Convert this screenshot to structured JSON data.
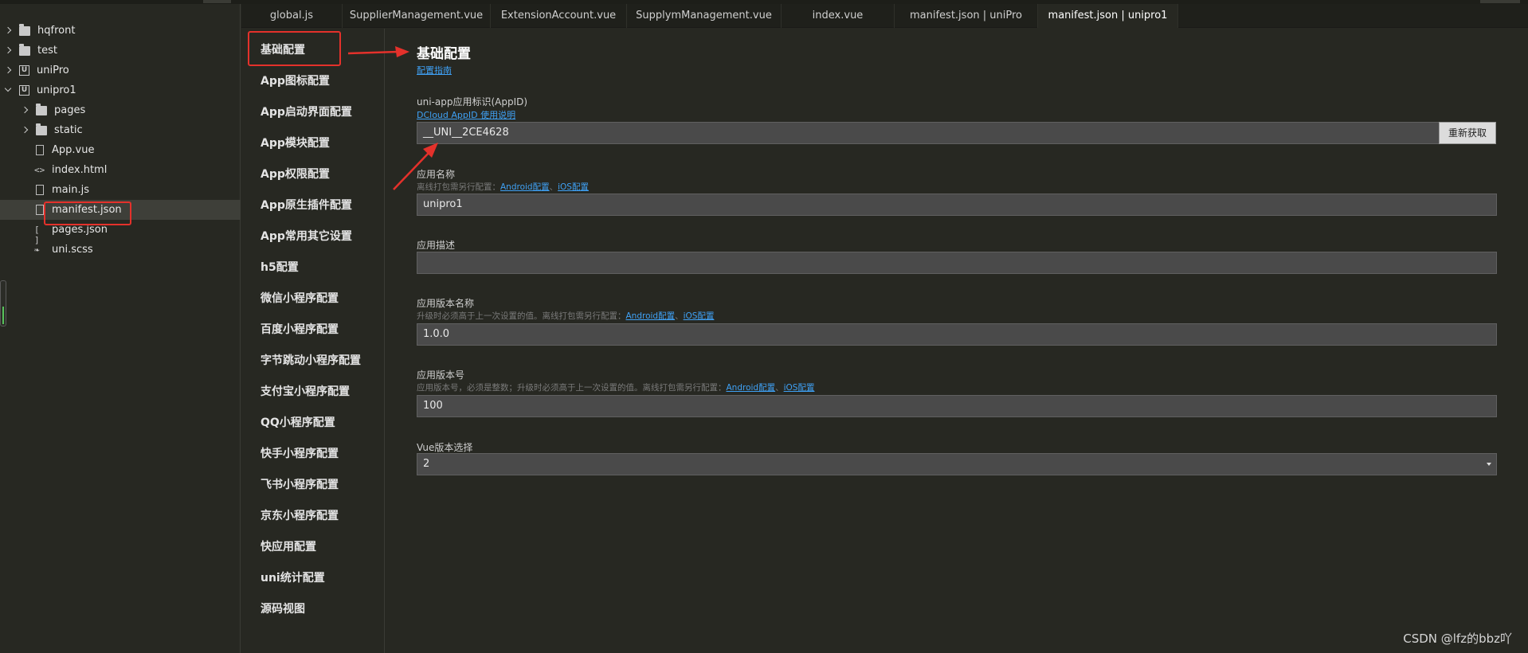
{
  "tree": {
    "items": [
      {
        "label": "hqfront",
        "icon": "folder-icon",
        "chev": "right"
      },
      {
        "label": "test",
        "icon": "folder-icon",
        "chev": "right"
      },
      {
        "label": "uniPro",
        "icon": "uni-project-icon",
        "chev": "right"
      },
      {
        "label": "unipro1",
        "icon": "uni-project-icon",
        "chev": "down"
      },
      {
        "label": "pages",
        "icon": "folder-icon",
        "chev": "right"
      },
      {
        "label": "static",
        "icon": "folder-icon",
        "chev": "right"
      },
      {
        "label": "App.vue",
        "icon": "vue-file-icon",
        "chev": ""
      },
      {
        "label": "index.html",
        "icon": "html-code-icon",
        "chev": ""
      },
      {
        "label": "main.js",
        "icon": "js-file-icon",
        "chev": ""
      },
      {
        "label": "manifest.json",
        "icon": "json-settings-icon",
        "chev": ""
      },
      {
        "label": "pages.json",
        "icon": "json-brackets-icon",
        "chev": ""
      },
      {
        "label": "uni.scss",
        "icon": "scss-file-icon",
        "chev": ""
      }
    ]
  },
  "tabs": [
    {
      "label": "global.js"
    },
    {
      "label": "SupplierManagement.vue"
    },
    {
      "label": "ExtensionAccount.vue"
    },
    {
      "label": "SupplymManagement.vue"
    },
    {
      "label": "index.vue"
    },
    {
      "label": "manifest.json | uniPro"
    },
    {
      "label": "manifest.json | unipro1"
    }
  ],
  "nav": {
    "items": [
      {
        "label": "基础配置"
      },
      {
        "label": "App图标配置"
      },
      {
        "label": "App启动界面配置"
      },
      {
        "label": "App模块配置"
      },
      {
        "label": "App权限配置"
      },
      {
        "label": "App原生插件配置"
      },
      {
        "label": "App常用其它设置"
      },
      {
        "label": "h5配置"
      },
      {
        "label": "微信小程序配置"
      },
      {
        "label": "百度小程序配置"
      },
      {
        "label": "字节跳动小程序配置"
      },
      {
        "label": "支付宝小程序配置"
      },
      {
        "label": "QQ小程序配置"
      },
      {
        "label": "快手小程序配置"
      },
      {
        "label": "飞书小程序配置"
      },
      {
        "label": "京东小程序配置"
      },
      {
        "label": "快应用配置"
      },
      {
        "label": "uni统计配置"
      },
      {
        "label": "源码视图"
      }
    ]
  },
  "content": {
    "title": "基础配置",
    "guide_link": "配置指南",
    "appid": {
      "label": "uni-app应用标识(AppID)",
      "link": "DCloud AppID 使用说明",
      "value": "__UNI__2CE4628",
      "button": "重新获取"
    },
    "app_name": {
      "label": "应用名称",
      "hint": "离线打包需另行配置：",
      "link_android": "Android配置",
      "sep": "、",
      "link_ios": "iOS配置",
      "value": "unipro1"
    },
    "app_desc": {
      "label": "应用描述",
      "value": ""
    },
    "version_name": {
      "label": "应用版本名称",
      "hint": "升级时必须高于上一次设置的值。离线打包需另行配置：",
      "link_android": "Android配置",
      "sep": "、",
      "link_ios": "iOS配置",
      "value": "1.0.0"
    },
    "version_code": {
      "label": "应用版本号",
      "hint": "应用版本号，必须是整数；升级时必须高于上一次设置的值。离线打包需另行配置：",
      "link_android": "Android配置",
      "sep": "、",
      "link_ios": "iOS配置",
      "value": "100"
    },
    "vue_version": {
      "label": "Vue版本选择",
      "value": "2"
    }
  },
  "watermark": "CSDN @lfz的bbz吖",
  "colors": {
    "background": "#272822",
    "highlight_red": "#e4312b",
    "link_blue": "#3fa1f5"
  }
}
